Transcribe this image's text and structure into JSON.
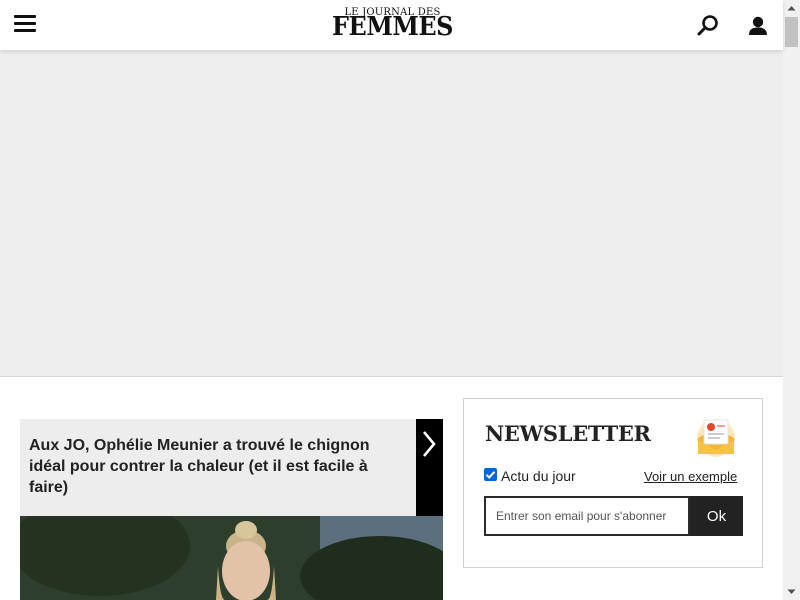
{
  "header": {
    "logo_top": "LE JOURNAL DES",
    "logo_main": "FEMMES",
    "icons": {
      "menu": "hamburger-menu-icon",
      "search": "search-icon",
      "account": "user-icon"
    }
  },
  "article": {
    "title": "Aux JO, Ophélie Meunier a trouvé le chignon idéal pour contrer la chaleur (et il est facile à faire)",
    "arrow_icon": "chevron-right-icon"
  },
  "newsletter": {
    "title": "NEWSLETTER",
    "checkbox_label": "Actu du jour",
    "checkbox_checked": true,
    "example_link": "Voir un exemple",
    "email_placeholder": "Entrer son email pour s'abonner",
    "submit_label": "Ok",
    "icon": "envelope-notification-icon"
  },
  "colors": {
    "ad_background": "#eeeeee",
    "card_background": "#ededed",
    "checkbox": "#0a66d8",
    "dark": "#222222"
  }
}
